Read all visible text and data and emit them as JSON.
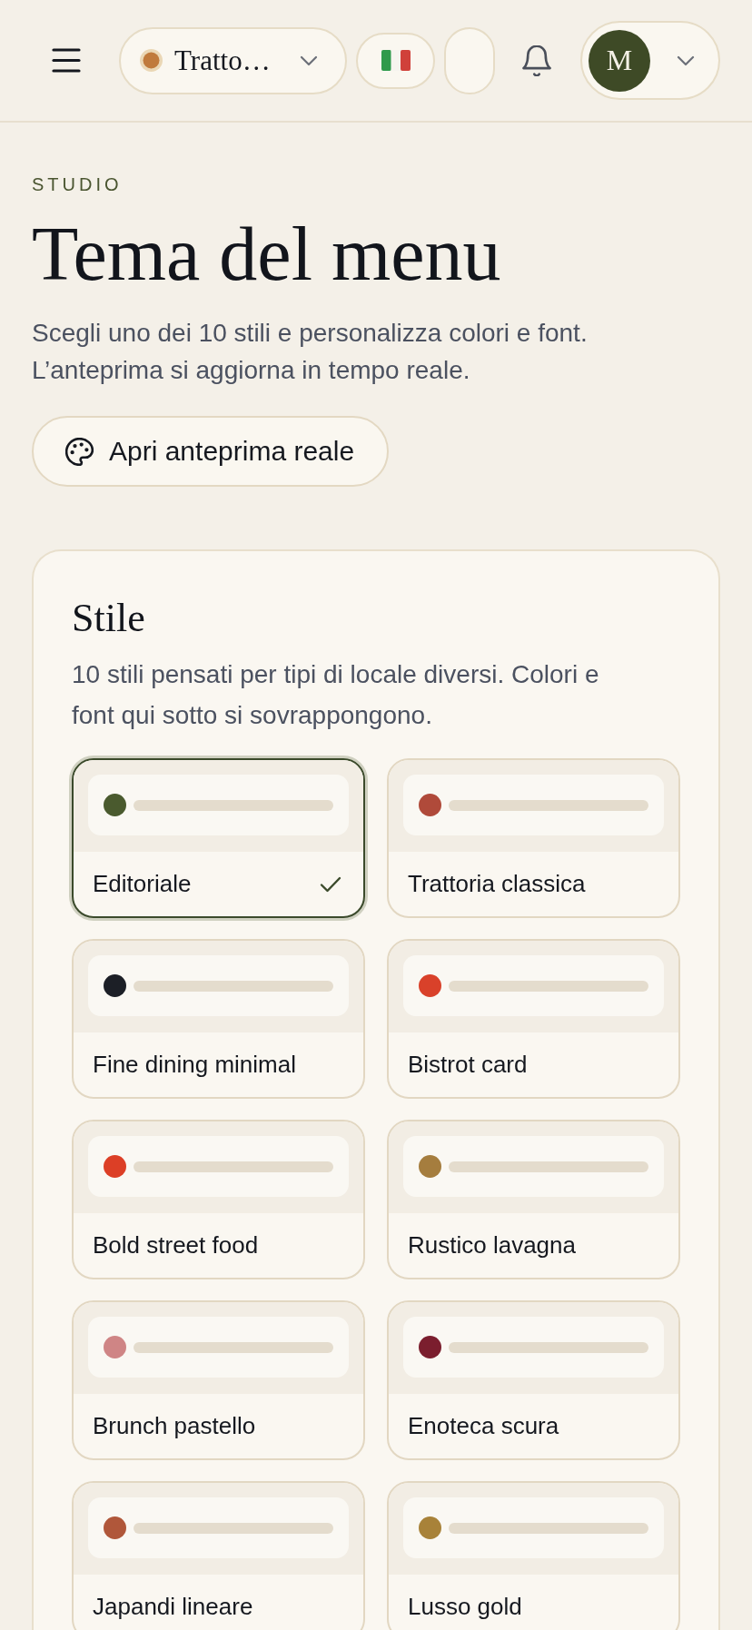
{
  "header": {
    "restaurant_name": "Tratto…",
    "user_initial": "M"
  },
  "intro": {
    "eyebrow": "STUDIO",
    "title": "Tema del menu",
    "description": "Scegli uno dei 10 stili e personalizza colori e font. L’anteprima si aggiorna in tempo reale.",
    "preview_button": "Apri anteprima reale"
  },
  "style_section": {
    "title": "Stile",
    "description": "10 stili pensati per tipi di locale diversi. Colori e font qui sotto si sovrappongono.",
    "styles": [
      {
        "name": "Editoriale",
        "selected": true,
        "color": "#4a5a2e"
      },
      {
        "name": "Trattoria classica",
        "selected": false,
        "color": "#b04a3a"
      },
      {
        "name": "Fine dining minimal",
        "selected": false,
        "color": "#1c1f26"
      },
      {
        "name": "Bistrot card",
        "selected": false,
        "color": "#d9412a"
      },
      {
        "name": "Bold street food",
        "selected": false,
        "color": "#dc3f26"
      },
      {
        "name": "Rustico lavagna",
        "selected": false,
        "color": "#a57d3e"
      },
      {
        "name": "Brunch pastello",
        "selected": false,
        "color": "#cf8585"
      },
      {
        "name": "Enoteca scura",
        "selected": false,
        "color": "#7b1e2e"
      },
      {
        "name": "Japandi lineare",
        "selected": false,
        "color": "#b0573a"
      },
      {
        "name": "Lusso gold",
        "selected": false,
        "color": "#a88239"
      }
    ]
  }
}
